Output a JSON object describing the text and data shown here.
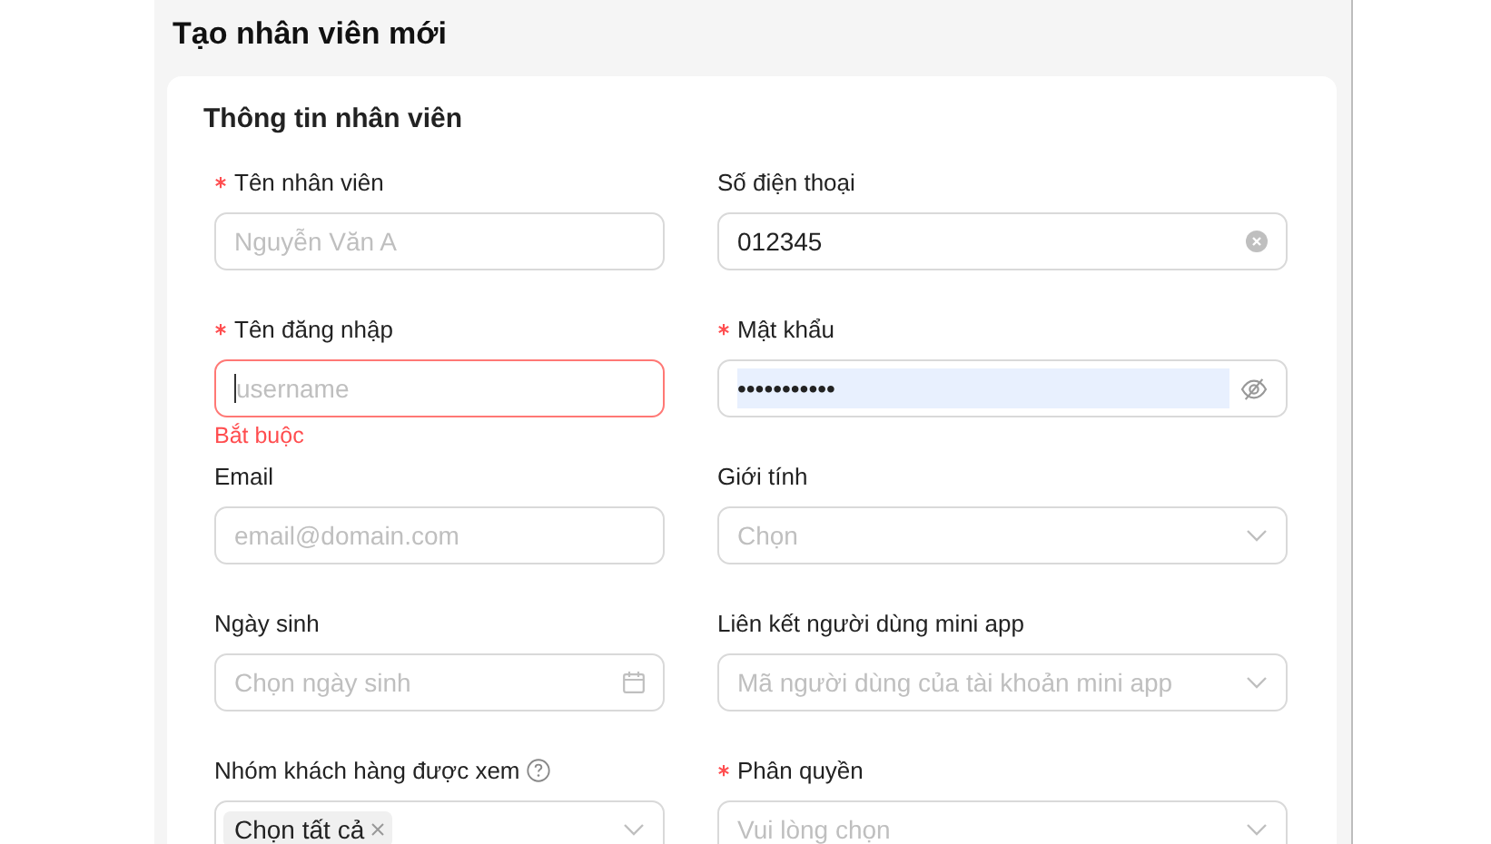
{
  "page_title": "Tạo nhân viên mới",
  "section_title": "Thông tin nhân viên",
  "fields": [
    {
      "kind": "text",
      "label": "Tên nhân viên",
      "required": true,
      "placeholder": "Nguyễn Văn A"
    },
    {
      "kind": "text",
      "label": "Số điện thoại",
      "required": false,
      "value": "012345",
      "clearable": true
    },
    {
      "kind": "text",
      "label": "Tên đăng nhập",
      "required": true,
      "placeholder": "username",
      "focused": true,
      "error": "Bắt buộc"
    },
    {
      "kind": "password",
      "label": "Mật khẩu",
      "required": true,
      "value": "•••••••••••",
      "autofilled": true
    },
    {
      "kind": "text",
      "label": "Email",
      "required": false,
      "placeholder": "email@domain.com"
    },
    {
      "kind": "select",
      "label": "Giới tính",
      "required": false,
      "placeholder": "Chọn"
    },
    {
      "kind": "date",
      "label": "Ngày sinh",
      "required": false,
      "placeholder": "Chọn ngày sinh"
    },
    {
      "kind": "select",
      "label": "Liên kết người dùng mini app",
      "required": false,
      "placeholder": "Mã người dùng của tài khoản mini app"
    },
    {
      "kind": "tags",
      "label": "Nhóm khách hàng được xem",
      "required": false,
      "help": true,
      "tags": [
        "Chọn tất cả"
      ]
    },
    {
      "kind": "select",
      "label": "Phân quyền",
      "required": true,
      "placeholder": "Vui lòng chọn"
    }
  ]
}
